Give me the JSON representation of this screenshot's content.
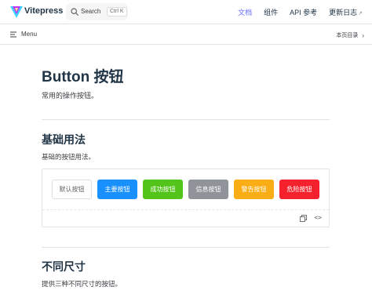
{
  "navbar": {
    "site_title": "Vitepress",
    "search_label": "Search",
    "search_shortcut": "Ctrl K",
    "links": [
      {
        "label": "文档",
        "active": true
      },
      {
        "label": "组件",
        "active": false
      },
      {
        "label": "API 参考",
        "active": false
      },
      {
        "label": "更新日志",
        "active": false
      }
    ]
  },
  "localnav": {
    "menu_label": "Menu",
    "outline_label": "本页目录"
  },
  "page": {
    "title": "Button 按钮",
    "intro": "常用的操作按钮。",
    "sections": [
      {
        "title": "基础用法",
        "description": "基础的按钮用法。"
      },
      {
        "title": "不同尺寸",
        "description": "提供三种不同尺寸的按钮。"
      }
    ]
  },
  "demo": {
    "buttons": [
      {
        "label": "默认按钮",
        "type": "default"
      },
      {
        "label": "主要按钮",
        "type": "primary"
      },
      {
        "label": "成功按钮",
        "type": "success"
      },
      {
        "label": "信息按钮",
        "type": "info"
      },
      {
        "label": "警告按钮",
        "type": "warning"
      },
      {
        "label": "危险按钮",
        "type": "danger"
      }
    ]
  },
  "icons": {
    "logo": "vitepress-logo-icon",
    "search": "search-icon",
    "menu": "menu-icon",
    "outline": "chevron-right-icon",
    "copy": "copy-icon",
    "code": "code-icon",
    "external": "external-link-icon"
  },
  "colors": {
    "accent": "#646cff",
    "primary": "#1890ff",
    "success": "#52c41a",
    "info": "#909399",
    "warning": "#faad14",
    "danger": "#f5222d"
  }
}
